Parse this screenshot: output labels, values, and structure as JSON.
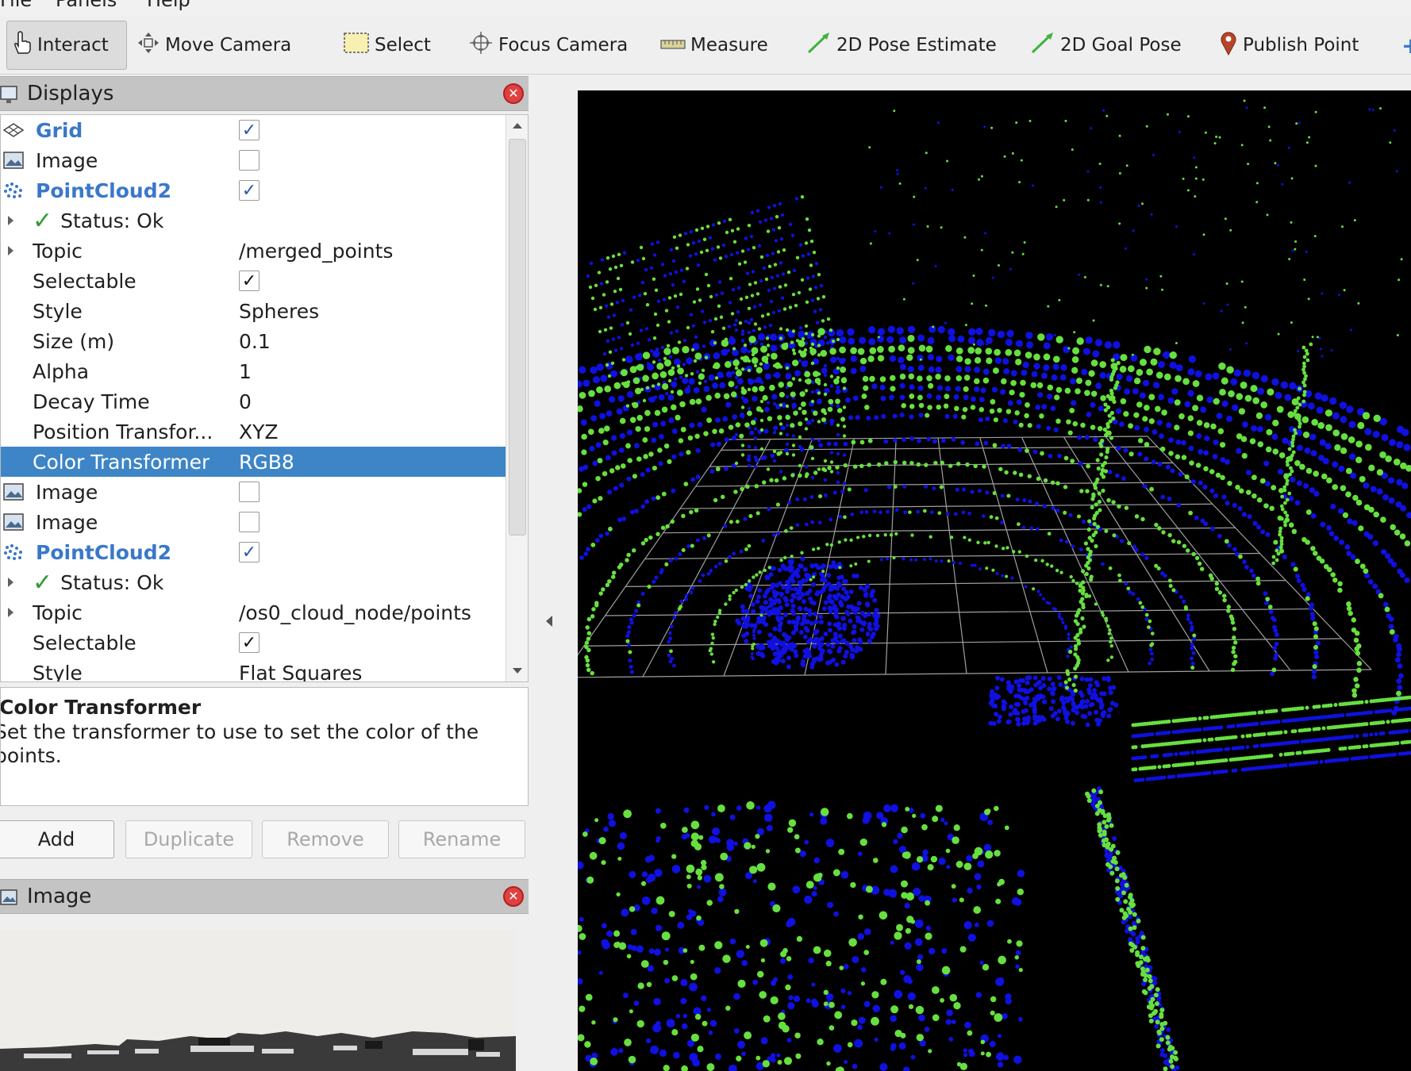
{
  "menu": {
    "file": "File",
    "panels": "Panels",
    "help": "Help"
  },
  "toolbar": {
    "interact": "Interact",
    "move_camera": "Move Camera",
    "select": "Select",
    "focus_camera": "Focus Camera",
    "measure": "Measure",
    "pose_estimate": "2D Pose Estimate",
    "goal_pose": "2D Goal Pose",
    "publish_point": "Publish Point"
  },
  "displays": {
    "title": "Displays",
    "rows": [
      {
        "label": "Grid",
        "value": "✓"
      },
      {
        "label": "Image",
        "value": ""
      },
      {
        "label": "PointCloud2",
        "value": "✓"
      },
      {
        "label": "Status: Ok",
        "value": ""
      },
      {
        "label": "Topic",
        "value": "/merged_points"
      },
      {
        "label": "Selectable",
        "value": "✓"
      },
      {
        "label": "Style",
        "value": "Spheres"
      },
      {
        "label": "Size (m)",
        "value": "0.1"
      },
      {
        "label": "Alpha",
        "value": "1"
      },
      {
        "label": "Decay Time",
        "value": "0"
      },
      {
        "label": "Position Transfor...",
        "value": "XYZ"
      },
      {
        "label": "Color Transformer",
        "value": "RGB8"
      },
      {
        "label": "Image",
        "value": ""
      },
      {
        "label": "Image",
        "value": ""
      },
      {
        "label": "PointCloud2",
        "value": "✓"
      },
      {
        "label": "Status: Ok",
        "value": ""
      },
      {
        "label": "Topic",
        "value": "/os0_cloud_node/points"
      },
      {
        "label": "Selectable",
        "value": "✓"
      },
      {
        "label": "Style",
        "value": "Flat Squares"
      }
    ],
    "description_title": "Color Transformer",
    "description_body": "Set the transformer to use to set the color of the points.",
    "buttons": {
      "add": "Add",
      "duplicate": "Duplicate",
      "remove": "Remove",
      "rename": "Rename"
    }
  },
  "image_panel": {
    "title": "Image"
  },
  "colors": {
    "accent": "#3d85c6",
    "points_green": "#66e040",
    "points_blue": "#1010e0",
    "grid": "#a0a0a0"
  }
}
